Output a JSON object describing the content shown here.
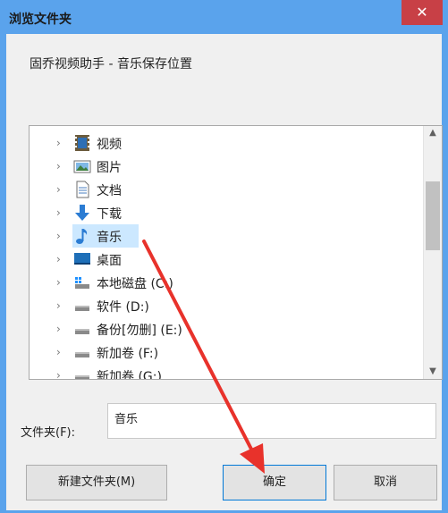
{
  "window": {
    "title": "浏览文件夹",
    "close_glyph": "✕"
  },
  "description": "固乔视频助手 - 音乐保存位置",
  "tree": {
    "items": [
      {
        "label": "视频",
        "icon": "video-icon"
      },
      {
        "label": "图片",
        "icon": "image-icon"
      },
      {
        "label": "文档",
        "icon": "document-icon"
      },
      {
        "label": "下载",
        "icon": "download-icon"
      },
      {
        "label": "音乐",
        "icon": "music-icon",
        "selected": true
      },
      {
        "label": "桌面",
        "icon": "desktop-icon"
      },
      {
        "label": "本地磁盘 (C:)",
        "icon": "windows-drive-icon"
      },
      {
        "label": "软件 (D:)",
        "icon": "drive-icon"
      },
      {
        "label": "备份[勿删] (E:)",
        "icon": "drive-icon"
      },
      {
        "label": "新加卷 (F:)",
        "icon": "drive-icon"
      },
      {
        "label": "新加卷 (G:)",
        "icon": "drive-icon"
      }
    ],
    "chevron": "›",
    "scroll_up": "▲",
    "scroll_down": "▼"
  },
  "folder": {
    "label": "文件夹(F):",
    "value": "音乐"
  },
  "buttons": {
    "new_folder": "新建文件夹(M)",
    "ok": "确定",
    "cancel": "取消"
  },
  "colors": {
    "titlebar": "#5aa3ec",
    "selection": "#cce8ff",
    "annotation_arrow": "#e8322b"
  }
}
